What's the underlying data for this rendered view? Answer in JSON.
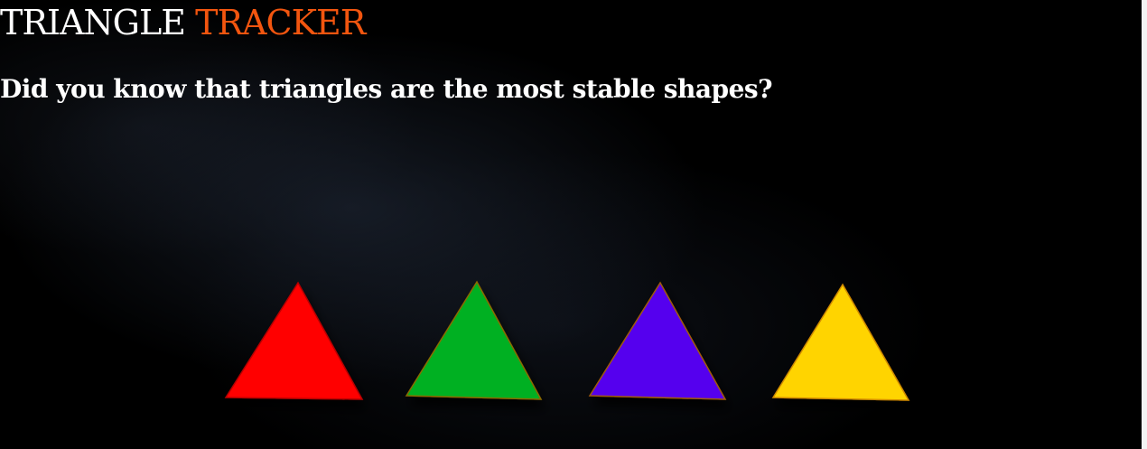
{
  "header": {
    "title_part1": "TRIANGLE",
    "title_part2": "TRACKER",
    "accent_color": "#f2550f"
  },
  "intro": {
    "text": "Did you know that triangles are the most stable shapes?"
  },
  "hero_image": {
    "triangles": [
      {
        "name": "red-triangle",
        "color": "#ff0000"
      },
      {
        "name": "green-triangle",
        "color": "#00b020"
      },
      {
        "name": "purple-triangle",
        "color": "#5500ee"
      },
      {
        "name": "yellow-triangle",
        "color": "#ffd400"
      }
    ]
  }
}
